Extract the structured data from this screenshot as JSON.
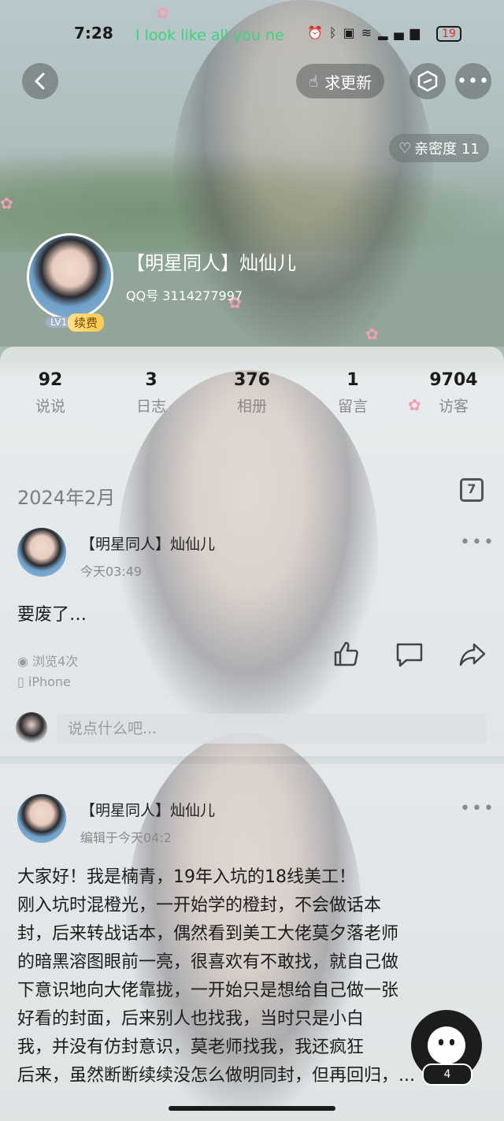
{
  "status_bar": {
    "time": "7:28",
    "lyric": "I look like all you ne",
    "battery": "19"
  },
  "nav": {
    "back_icon": "chevron-left-icon",
    "request_update_label": "求更新",
    "more_icon": "ellipsis-icon"
  },
  "intimacy": {
    "label": "亲密度 11"
  },
  "profile": {
    "name": "【明星同人】灿仙儿",
    "qq": "QQ号 3114277997",
    "level": "LV1",
    "renew_label": "续费"
  },
  "stats": [
    {
      "count": "92",
      "label": "说说"
    },
    {
      "count": "3",
      "label": "日志"
    },
    {
      "count": "376",
      "label": "相册"
    },
    {
      "count": "1",
      "label": "留言"
    },
    {
      "count": "9704",
      "label": "访客"
    }
  ],
  "feed": {
    "month": "2024年2月",
    "calendar_day": "7",
    "posts": [
      {
        "author": "【明星同人】灿仙儿",
        "time": "今天03:49",
        "text": "要废了…",
        "views": "浏览4次",
        "device": "iPhone"
      },
      {
        "author": "【明星同人】灿仙儿",
        "time": "编辑于今天04:2",
        "lines": [
          "大家好！我是楠青，19年入坑的18线美工！",
          "刚入坑时混橙光，一开始学的橙封，不会做话本",
          "封，后来转战话本，偶然看到美工大佬莫夕落老师",
          "的暗黑溶图眼前一亮，很喜欢有不敢找，就自己做",
          "下意识地向大佬靠拢，一开始只是想给自己做一张",
          "好看的封面，后来别人也找我，当时只是小白",
          "我，并没有仿封意识，莫老师找我，我还疯狂",
          "后来，虽然断断续续没怎么做明同封，但再回归，..."
        ]
      }
    ],
    "comment_placeholder": "说点什么吧..."
  },
  "floating": {
    "count": "4"
  }
}
